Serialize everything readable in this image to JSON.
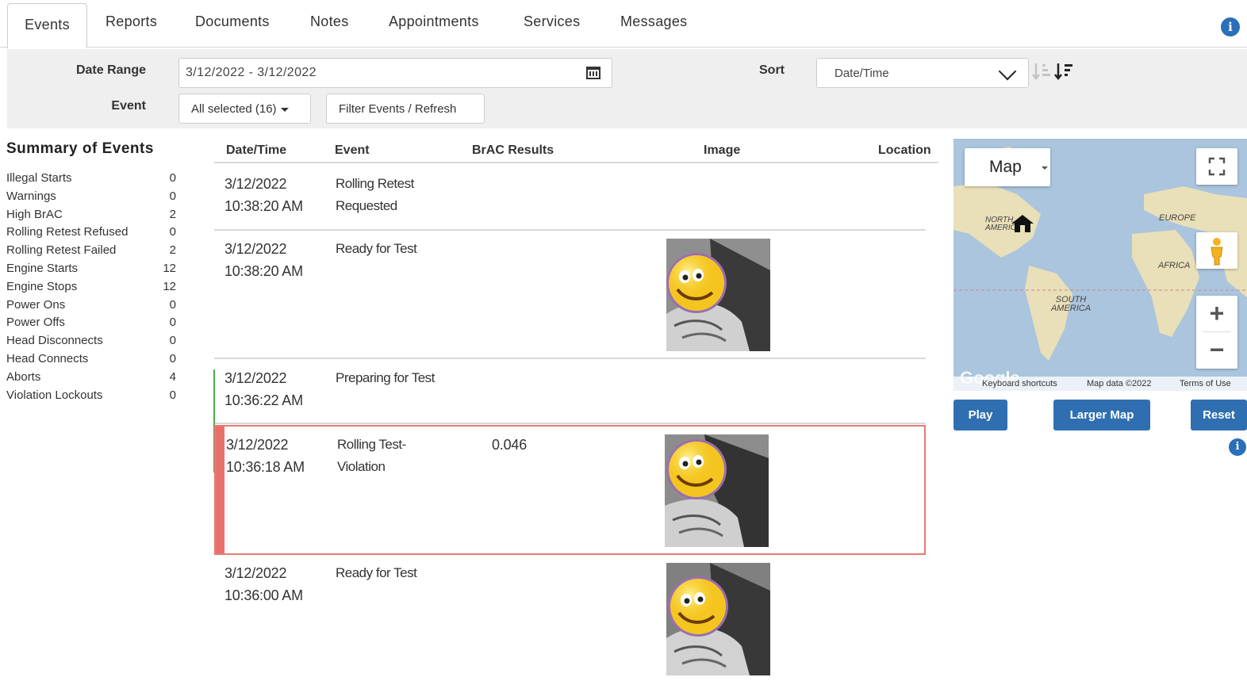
{
  "tabs": [
    {
      "label": "Events",
      "active": true
    },
    {
      "label": "Reports"
    },
    {
      "label": "Documents"
    },
    {
      "label": "Notes"
    },
    {
      "label": "Appointments"
    },
    {
      "label": "Services"
    },
    {
      "label": "Messages"
    }
  ],
  "info_glyph": "i",
  "filters": {
    "date_range_label": "Date Range",
    "date_range_value": "3/12/2022 - 3/12/2022",
    "event_label": "Event",
    "event_select_value": "All selected (16)",
    "filter_button": "Filter Events / Refresh",
    "sort_label": "Sort",
    "sort_value": "Date/Time"
  },
  "summary": {
    "title": "Summary of Events",
    "items": [
      {
        "label": "Illegal Starts",
        "count": "0"
      },
      {
        "label": "Warnings",
        "count": "0"
      },
      {
        "label": "High BrAC",
        "count": "2"
      },
      {
        "label": "Rolling Retest Refused",
        "count": "0"
      },
      {
        "label": "Rolling Retest Failed",
        "count": "2"
      },
      {
        "label": "Engine Starts",
        "count": "12"
      },
      {
        "label": "Engine Stops",
        "count": "12"
      },
      {
        "label": "Power Ons",
        "count": "0"
      },
      {
        "label": "Power Offs",
        "count": "0"
      },
      {
        "label": "Head Disconnects",
        "count": "0"
      },
      {
        "label": "Head Connects",
        "count": "0"
      },
      {
        "label": "Aborts",
        "count": "4"
      },
      {
        "label": "Violation Lockouts",
        "count": "0"
      }
    ]
  },
  "table": {
    "headers": {
      "datetime": "Date/Time",
      "event": "Event",
      "brac": "BrAC Results",
      "image": "Image",
      "location": "Location"
    },
    "rows": [
      {
        "date": "3/12/2022",
        "time": "10:38:20 AM",
        "event1": "Rolling Retest",
        "event2": "Requested",
        "brac": "",
        "has_image": false
      },
      {
        "date": "3/12/2022",
        "time": "10:38:20 AM",
        "event1": "Ready for Test",
        "event2": "",
        "brac": "",
        "has_image": true
      },
      {
        "date": "3/12/2022",
        "time": "10:36:22 AM",
        "event1": "Preparing for Test",
        "event2": "",
        "brac": "",
        "has_image": false
      },
      {
        "date": "3/12/2022",
        "time": "10:36:18 AM",
        "event1": "Rolling Test-",
        "event2": "Violation",
        "brac": "0.046",
        "has_image": true,
        "violation": true
      },
      {
        "date": "3/12/2022",
        "time": "10:36:00 AM",
        "event1": "Ready for Test",
        "event2": "",
        "brac": "",
        "has_image": true
      }
    ]
  },
  "map": {
    "type_label": "Map",
    "labels": {
      "north_america": "NORTH AMERICA",
      "europe": "EUROPE",
      "africa": "AFRICA",
      "south_america": "SOUTH AMERICA"
    },
    "google_logo": "Google",
    "footer": {
      "shortcuts": "Keyboard shortcuts",
      "data": "Map data ©2022",
      "terms": "Terms of Use"
    },
    "zoom_in": "+",
    "zoom_out": "−"
  },
  "map_buttons": {
    "play": "Play",
    "larger": "Larger Map",
    "reset": "Reset"
  },
  "colors": {
    "accent": "#2f6fb1",
    "violation": "#e8706a",
    "status_green": "#4cae4c"
  }
}
